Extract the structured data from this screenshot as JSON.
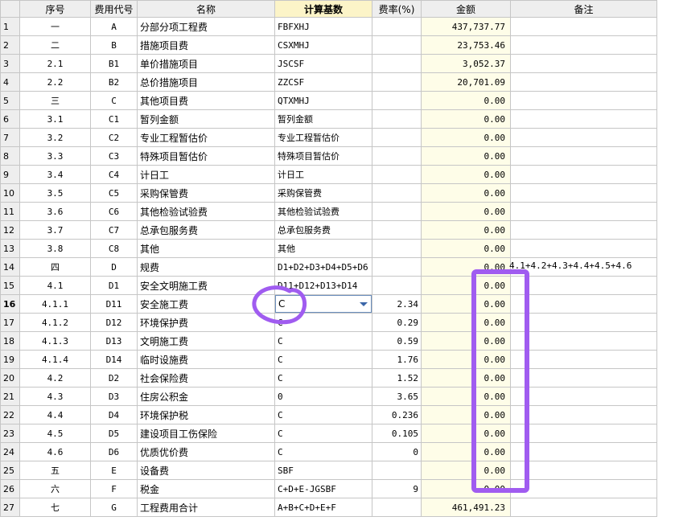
{
  "columns": [
    "",
    "序号",
    "费用代号",
    "名称",
    "计算基数",
    "费率(%)",
    "金额",
    "备注"
  ],
  "active_row": "16",
  "rows": [
    {
      "n": "1",
      "seq": "一",
      "code": "A",
      "name": "分部分项工程费",
      "base": "FBFXHJ",
      "rate": "",
      "amount": "437,737.77",
      "note": ""
    },
    {
      "n": "2",
      "seq": "二",
      "code": "B",
      "name": "措施项目费",
      "base": "CSXMHJ",
      "rate": "",
      "amount": "23,753.46",
      "note": ""
    },
    {
      "n": "3",
      "seq": "2.1",
      "code": "B1",
      "name": "单价措施项目",
      "base": "JSCSF",
      "rate": "",
      "amount": "3,052.37",
      "note": ""
    },
    {
      "n": "4",
      "seq": "2.2",
      "code": "B2",
      "name": "总价措施项目",
      "base": "ZZCSF",
      "rate": "",
      "amount": "20,701.09",
      "note": ""
    },
    {
      "n": "5",
      "seq": "三",
      "code": "C",
      "name": "其他项目费",
      "base": "QTXMHJ",
      "rate": "",
      "amount": "0.00",
      "note": ""
    },
    {
      "n": "6",
      "seq": "3.1",
      "code": "C1",
      "name": "暂列金额",
      "base": "暂列金额",
      "rate": "",
      "amount": "0.00",
      "note": ""
    },
    {
      "n": "7",
      "seq": "3.2",
      "code": "C2",
      "name": "专业工程暂估价",
      "base": "专业工程暂估价",
      "rate": "",
      "amount": "0.00",
      "note": ""
    },
    {
      "n": "8",
      "seq": "3.3",
      "code": "C3",
      "name": "特殊项目暂估价",
      "base": "特殊项目暂估价",
      "rate": "",
      "amount": "0.00",
      "note": ""
    },
    {
      "n": "9",
      "seq": "3.4",
      "code": "C4",
      "name": "计日工",
      "base": "计日工",
      "rate": "",
      "amount": "0.00",
      "note": ""
    },
    {
      "n": "10",
      "seq": "3.5",
      "code": "C5",
      "name": "采购保管费",
      "base": "采购保管费",
      "rate": "",
      "amount": "0.00",
      "note": ""
    },
    {
      "n": "11",
      "seq": "3.6",
      "code": "C6",
      "name": "其他检验试验费",
      "base": "其他检验试验费",
      "rate": "",
      "amount": "0.00",
      "note": ""
    },
    {
      "n": "12",
      "seq": "3.7",
      "code": "C7",
      "name": "总承包服务费",
      "base": "总承包服务费",
      "rate": "",
      "amount": "0.00",
      "note": ""
    },
    {
      "n": "13",
      "seq": "3.8",
      "code": "C8",
      "name": "其他",
      "base": "其他",
      "rate": "",
      "amount": "0.00",
      "note": ""
    },
    {
      "n": "14",
      "seq": "四",
      "code": "D",
      "name": "规费",
      "base": "D1+D2+D3+D4+D5+D6",
      "rate": "",
      "amount": "0.00",
      "note": "4.1+4.2+4.3+4.4+4.5+4.6"
    },
    {
      "n": "15",
      "seq": "4.1",
      "code": "D1",
      "name": "安全文明施工费",
      "base": "D11+D12+D13+D14",
      "rate": "",
      "amount": "0.00",
      "note": ""
    },
    {
      "n": "16",
      "seq": "4.1.1",
      "code": "D11",
      "name": "安全施工费",
      "base": "C",
      "rate": "2.34",
      "amount": "0.00",
      "note": ""
    },
    {
      "n": "17",
      "seq": "4.1.2",
      "code": "D12",
      "name": "环境保护费",
      "base": "C",
      "rate": "0.29",
      "amount": "0.00",
      "note": ""
    },
    {
      "n": "18",
      "seq": "4.1.3",
      "code": "D13",
      "name": "文明施工费",
      "base": "C",
      "rate": "0.59",
      "amount": "0.00",
      "note": ""
    },
    {
      "n": "19",
      "seq": "4.1.4",
      "code": "D14",
      "name": "临时设施费",
      "base": "C",
      "rate": "1.76",
      "amount": "0.00",
      "note": ""
    },
    {
      "n": "20",
      "seq": "4.2",
      "code": "D2",
      "name": "社会保险费",
      "base": "C",
      "rate": "1.52",
      "amount": "0.00",
      "note": ""
    },
    {
      "n": "21",
      "seq": "4.3",
      "code": "D3",
      "name": "住房公积金",
      "base": "0",
      "rate": "3.65",
      "amount": "0.00",
      "note": ""
    },
    {
      "n": "22",
      "seq": "4.4",
      "code": "D4",
      "name": "环境保护税",
      "base": "C",
      "rate": "0.236",
      "amount": "0.00",
      "note": ""
    },
    {
      "n": "23",
      "seq": "4.5",
      "code": "D5",
      "name": "建设项目工伤保险",
      "base": "C",
      "rate": "0.105",
      "amount": "0.00",
      "note": ""
    },
    {
      "n": "24",
      "seq": "4.6",
      "code": "D6",
      "name": "优质优价费",
      "base": "C",
      "rate": "0",
      "amount": "0.00",
      "note": ""
    },
    {
      "n": "25",
      "seq": "五",
      "code": "E",
      "name": "设备费",
      "base": "SBF",
      "rate": "",
      "amount": "0.00",
      "note": ""
    },
    {
      "n": "26",
      "seq": "六",
      "code": "F",
      "name": "税金",
      "base": "C+D+E-JGSBF",
      "rate": "9",
      "amount": "0.00",
      "note": ""
    },
    {
      "n": "27",
      "seq": "七",
      "code": "G",
      "name": "工程费用合计",
      "base": "A+B+C+D+E+F",
      "rate": "",
      "amount": "461,491.23",
      "note": ""
    }
  ],
  "annotation_color": "#a05cf0"
}
